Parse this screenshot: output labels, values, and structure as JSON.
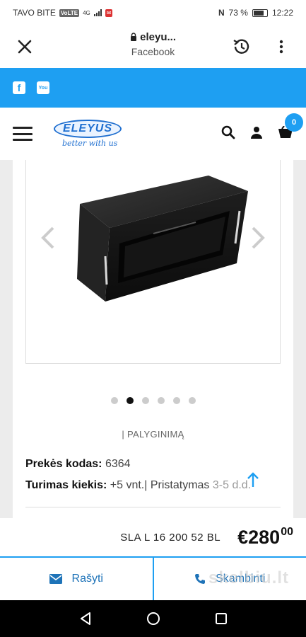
{
  "status_bar": {
    "carrier": "TAVO BITE",
    "badge1": "VoLTE",
    "network": "4G",
    "battery": "73 %",
    "time": "12:22",
    "nfc": "N"
  },
  "browser": {
    "url": "eleyu...",
    "source": "Facebook"
  },
  "social": {
    "facebook_glyph": "f",
    "youtube_glyph": "You"
  },
  "site_header": {
    "logo_text": "ELEYUS",
    "tagline": "better with us",
    "cart_count": "0"
  },
  "product": {
    "compare_label": "| PALYGINIMĄ",
    "code_label": "Prekės kodas:",
    "code_value": "6364",
    "stock_label": "Turimas kiekis:",
    "stock_value": "+5 vnt.| Pristatymas",
    "delivery_value": "3-5 d.d.",
    "gallery": {
      "slide_count": 6,
      "active_index": 1
    },
    "sku": "SLA L 16 200 52 BL",
    "price_main": "€280",
    "price_cents": "00"
  },
  "contact": {
    "write_label": "Rašyti",
    "call_label": "Skambinti"
  },
  "watermark": "skelbiu.lt",
  "colors": {
    "accent_blue": "#1e9ff2",
    "logo_blue": "#1f6fd0",
    "link_blue": "#1e73b8"
  },
  "icons": [
    "close-icon",
    "lock-icon",
    "history-icon",
    "more-vert-icon",
    "facebook-icon",
    "youtube-icon",
    "menu-icon",
    "search-icon",
    "user-icon",
    "cart-icon",
    "chevron-left-icon",
    "chevron-right-icon",
    "arrow-up-icon",
    "mail-icon",
    "phone-icon",
    "back-icon",
    "home-icon",
    "recents-icon"
  ]
}
